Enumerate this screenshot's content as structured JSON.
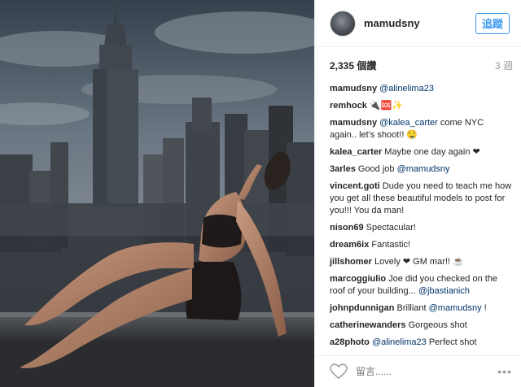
{
  "header": {
    "username": "mamudsny",
    "follow_label": "追蹤"
  },
  "stats": {
    "views": "2,335 個讚",
    "time": "3 週"
  },
  "comments": [
    {
      "user": "mamudsny",
      "parts": [
        {
          "t": "@alinelima23",
          "m": true
        }
      ]
    },
    {
      "user": "remhock",
      "parts": [
        {
          "t": "🔌🆘✨",
          "m": false
        }
      ]
    },
    {
      "user": "mamudsny",
      "parts": [
        {
          "t": "@kalea_carter",
          "m": true
        },
        {
          "t": " come NYC again.. let's shoot!! 🤤",
          "m": false
        }
      ]
    },
    {
      "user": "kalea_carter",
      "parts": [
        {
          "t": "Maybe one day again ❤",
          "m": false
        }
      ]
    },
    {
      "user": "3arles",
      "parts": [
        {
          "t": "Good job ",
          "m": false
        },
        {
          "t": "@mamudsny",
          "m": true
        }
      ]
    },
    {
      "user": "vincent.goti",
      "parts": [
        {
          "t": "Dude you need to teach me how you get all these beautiful models to post for you!!! You da man!",
          "m": false
        }
      ]
    },
    {
      "user": "nison69",
      "parts": [
        {
          "t": "Spectacular!",
          "m": false
        }
      ]
    },
    {
      "user": "dream6ix",
      "parts": [
        {
          "t": "Fantastic!",
          "m": false
        }
      ]
    },
    {
      "user": "jillshomer",
      "parts": [
        {
          "t": "Lovely ❤ GM mar!! ☕",
          "m": false
        }
      ]
    },
    {
      "user": "marcoggiulio",
      "parts": [
        {
          "t": "Joe did you checked on the roof of your building... ",
          "m": false
        },
        {
          "t": "@jbastianich",
          "m": true
        }
      ]
    },
    {
      "user": "johnpdunnigan",
      "parts": [
        {
          "t": "Brilliant ",
          "m": false
        },
        {
          "t": "@mamudsny",
          "m": true
        },
        {
          "t": " !",
          "m": false
        }
      ]
    },
    {
      "user": "catherinewanders",
      "parts": [
        {
          "t": "Gorgeous shot",
          "m": false
        }
      ]
    },
    {
      "user": "a28photo",
      "parts": [
        {
          "t": "@alinelima23",
          "m": true
        },
        {
          "t": " Perfect shot",
          "m": false
        }
      ]
    }
  ],
  "footer": {
    "comment_placeholder": "留言......",
    "more_icon": "more-horizontal-icon",
    "more_symbol": "•••",
    "like_icon": "heart-outline-icon"
  },
  "colors": {
    "link": "#003569",
    "accent": "#3897f0"
  }
}
